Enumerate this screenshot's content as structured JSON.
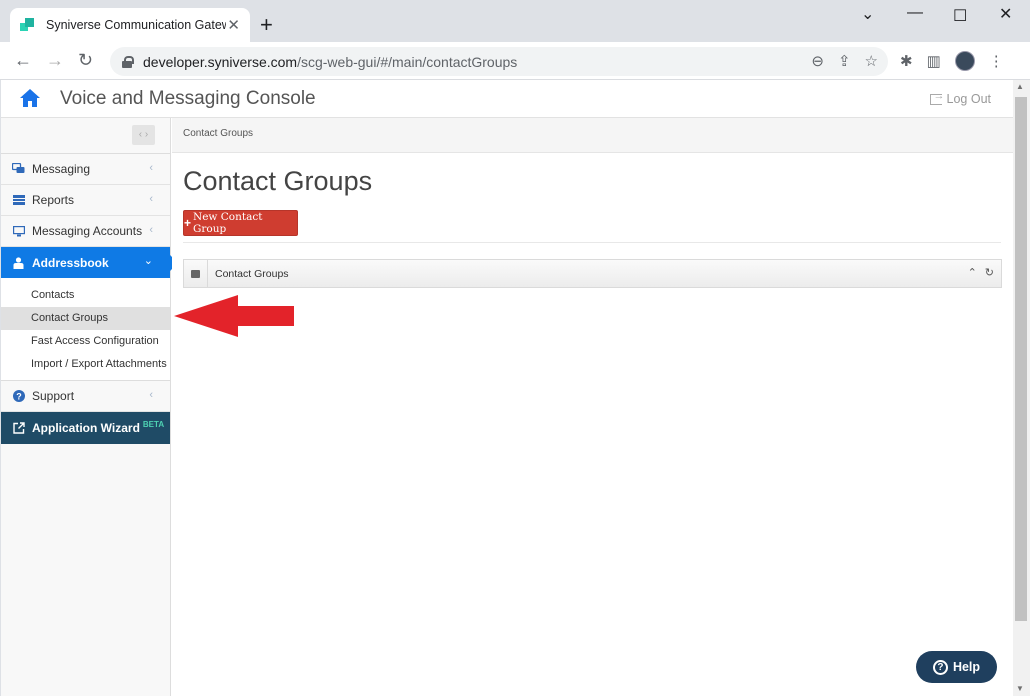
{
  "browser": {
    "tab_title": "Syniverse Communication Gatew",
    "tab_close": "✕",
    "new_tab": "+",
    "url_host": "developer.syniverse.com",
    "url_path": "/scg-web-gui/#/main/contactGroups"
  },
  "header": {
    "title": "Voice and Messaging Console",
    "logout": "Log Out"
  },
  "sidebar": {
    "collapse_label": "‹ ›",
    "items": [
      {
        "label": "Messaging"
      },
      {
        "label": "Reports"
      },
      {
        "label": "Messaging Accounts"
      },
      {
        "label": "Addressbook"
      }
    ],
    "sub_items": [
      {
        "label": "Contacts"
      },
      {
        "label": "Contact Groups"
      },
      {
        "label": "Fast Access Configuration"
      },
      {
        "label": "Import / Export Attachments"
      }
    ],
    "support": "Support",
    "wizard": "Application Wizard",
    "wizard_badge": "BETA"
  },
  "main": {
    "breadcrumb": "Contact Groups",
    "page_title": "Contact Groups",
    "new_button": "New Contact Group",
    "widget_title": "Contact Groups"
  },
  "help": {
    "label": "Help"
  },
  "colors": {
    "active_nav": "#0f7ae5",
    "new_button": "#cf3d30",
    "wizard_bg": "#1f4b66",
    "help_bg": "#1f3f5e",
    "annotation_arrow": "#e3232a"
  }
}
